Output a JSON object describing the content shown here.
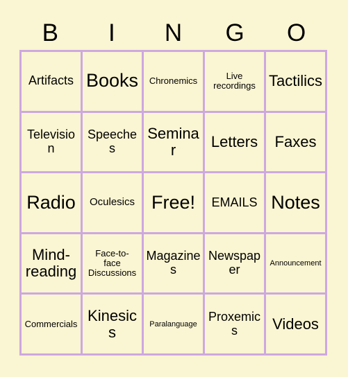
{
  "card": {
    "header_letters": [
      "B",
      "I",
      "N",
      "G",
      "O"
    ],
    "background_color": "#faf5d2",
    "grid_line_color": "#cda8e0",
    "text_color": "#000000",
    "rows": 5,
    "columns": 5,
    "cells": [
      {
        "text": "Artifacts",
        "size": "md",
        "free": false
      },
      {
        "text": "Books",
        "size": "xl",
        "free": false
      },
      {
        "text": "Chronemics",
        "size": "xs",
        "free": false
      },
      {
        "text": "Live\nrecordings",
        "size": "xs",
        "free": false
      },
      {
        "text": "Tactilics",
        "size": "lg",
        "free": false
      },
      {
        "text": "Television",
        "size": "md",
        "free": false
      },
      {
        "text": "Speeches",
        "size": "md",
        "free": false
      },
      {
        "text": "Seminar",
        "size": "lg",
        "free": false
      },
      {
        "text": "Letters",
        "size": "lg",
        "free": false
      },
      {
        "text": "Faxes",
        "size": "lg",
        "free": false
      },
      {
        "text": "Radio",
        "size": "xl",
        "free": false
      },
      {
        "text": "Oculesics",
        "size": "sm",
        "free": false
      },
      {
        "text": "Free!",
        "size": "xl",
        "free": true
      },
      {
        "text": "EMAILS",
        "size": "md",
        "free": false
      },
      {
        "text": "Notes",
        "size": "xl",
        "free": false
      },
      {
        "text": "Mind-\nreading",
        "size": "lg",
        "free": false
      },
      {
        "text": "Face-to-\nface\nDiscussions",
        "size": "xs",
        "free": false
      },
      {
        "text": "Magazines",
        "size": "md",
        "free": false
      },
      {
        "text": "Newspaper",
        "size": "md",
        "free": false
      },
      {
        "text": "Announcement",
        "size": "xxs",
        "free": false
      },
      {
        "text": "Commercials",
        "size": "xs",
        "free": false
      },
      {
        "text": "Kinesics",
        "size": "lg",
        "free": false
      },
      {
        "text": "Paralanguage",
        "size": "xxs",
        "free": false
      },
      {
        "text": "Proxemics",
        "size": "md",
        "free": false
      },
      {
        "text": "Videos",
        "size": "lg",
        "free": false
      }
    ]
  }
}
